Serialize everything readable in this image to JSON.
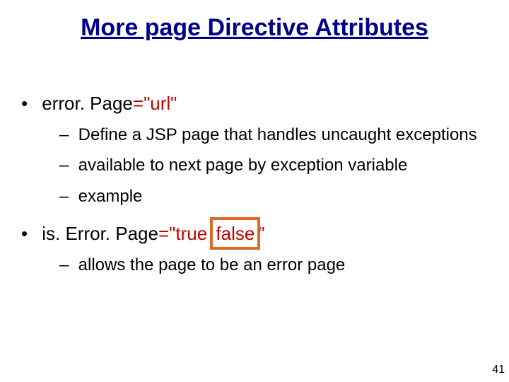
{
  "title": "More page Directive Attributes",
  "items": {
    "p1": {
      "attr": "error. Page",
      "eq": "=",
      "val": "\"url\"",
      "sub1": "Define a JSP page that handles uncaught exceptions",
      "sub2": "available to next page by exception variable",
      "sub3": "example"
    },
    "p2": {
      "attr": "is. Error. Page",
      "eq": "=",
      "val_open": "\"true ",
      "val_emph": "false",
      "val_close": "\"",
      "sub1": "allows the page to be an error page"
    }
  },
  "page_number": "41",
  "colors": {
    "title": "#00008b",
    "accent_red": "#c00000",
    "box_border": "#e0692a"
  }
}
